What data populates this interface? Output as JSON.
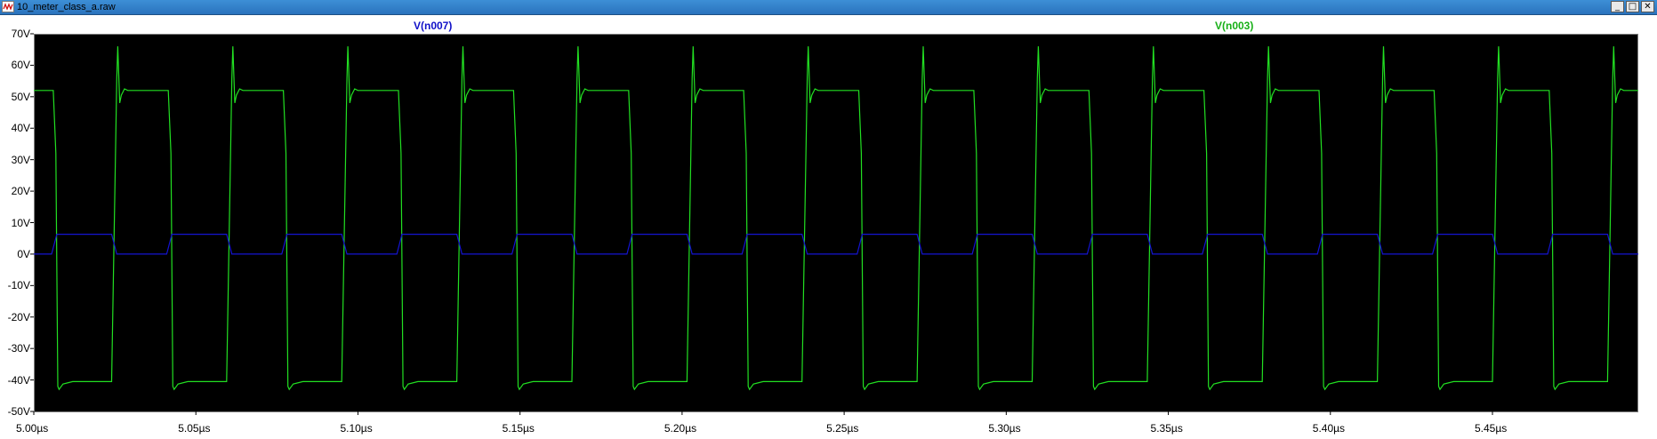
{
  "window": {
    "title": "10_meter_class_a.raw",
    "buttons": {
      "minimize": "_",
      "maximize": "□",
      "close": "✕"
    },
    "icon": "waveform-icon"
  },
  "traces": {
    "n007": {
      "label": "V(n007)",
      "color": "#1414d2"
    },
    "n003": {
      "label": "V(n003)",
      "color": "#22e022"
    }
  },
  "chart_data": {
    "type": "line",
    "xlim": [
      5.0,
      5.495
    ],
    "ylim": [
      -50,
      70
    ],
    "x_unit": "µs",
    "y_unit": "V",
    "grid": false,
    "yticks": [
      "70V",
      "60V",
      "50V",
      "40V",
      "30V",
      "20V",
      "10V",
      "0V",
      "-10V",
      "-20V",
      "-30V",
      "-40V",
      "-50V"
    ],
    "xticks": [
      "5.00µs",
      "5.05µs",
      "5.10µs",
      "5.15µs",
      "5.20µs",
      "5.25µs",
      "5.30µs",
      "5.35µs",
      "5.40µs",
      "5.45µs"
    ],
    "period_us": 0.0355,
    "series": [
      {
        "name": "V(n007)",
        "shape": "square",
        "high": 6.3,
        "low": 0,
        "first_rise_us": 5.0055,
        "high_duration_us": 0.0185
      },
      {
        "name": "V(n003)",
        "shape": "square-with-ringing",
        "high": 52,
        "low": -40.5,
        "peak": 66,
        "trough": -43,
        "first_rise_us": 5.024,
        "high_duration_us": 0.0175
      }
    ]
  }
}
